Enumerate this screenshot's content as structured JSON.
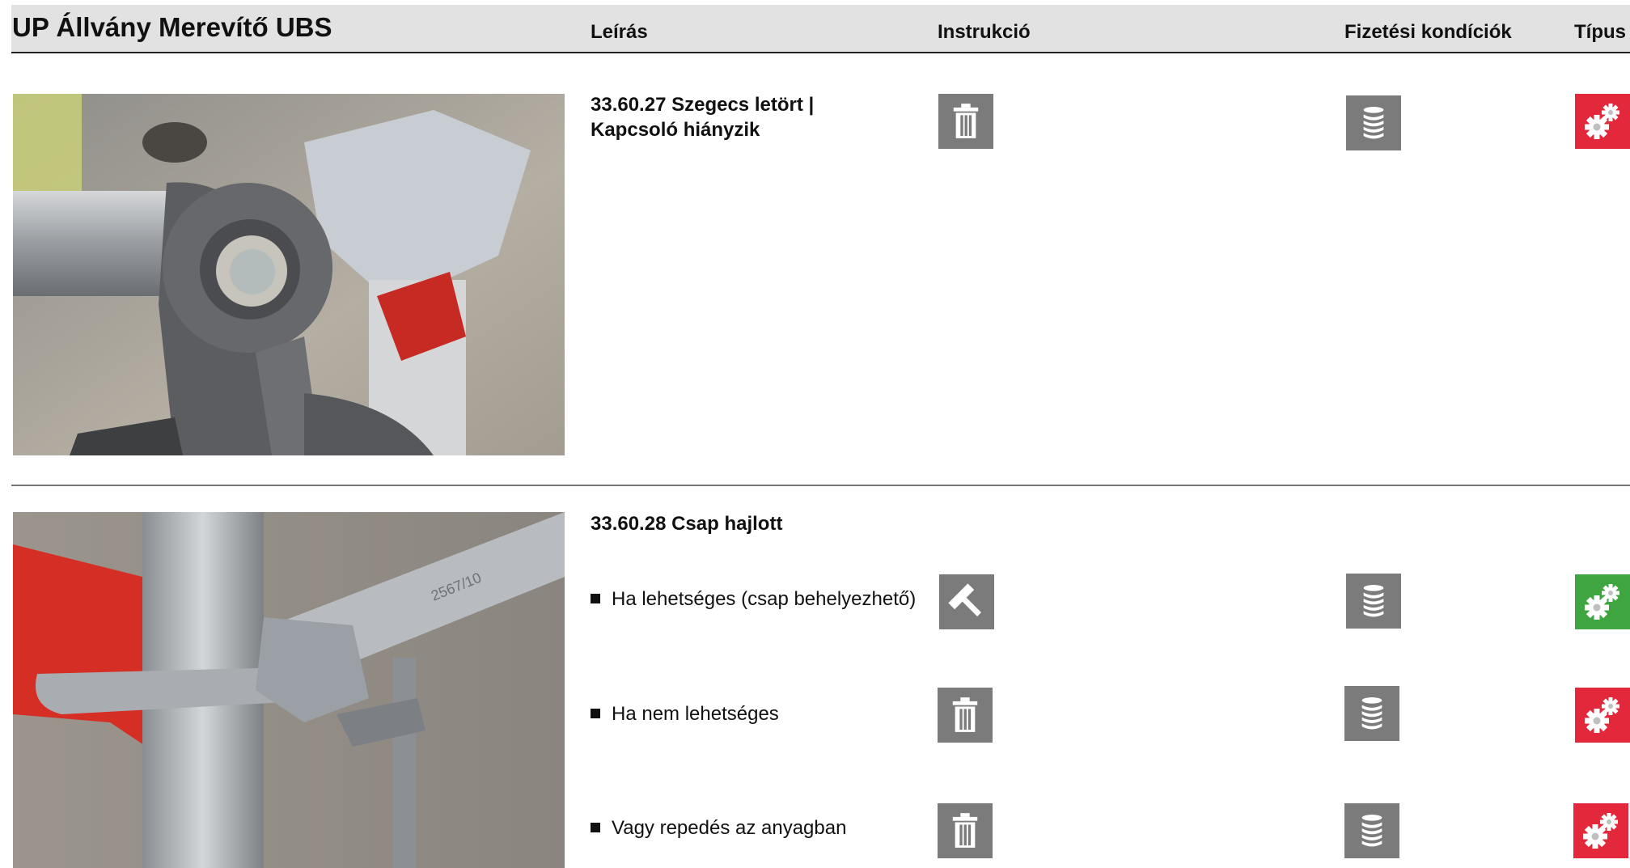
{
  "header": {
    "title": "UP Állvány Merevítő UBS",
    "col_description": "Leírás",
    "col_instruction": "Instrukció",
    "col_payment": "Fizetési kondíciók",
    "col_type": "Típus"
  },
  "items": [
    {
      "code_title_line1": "33.60.27 Szegecs letört |",
      "code_title_line2": "Kapcsoló hiányzik",
      "instruction_icon": "trash-icon",
      "payment_icon": "coin-stack-icon",
      "type_icon": "gears-icon",
      "type_color": "#e2283a"
    },
    {
      "code_title": "33.60.28 Csap hajlott",
      "options": [
        {
          "label": "Ha lehetséges (csap behelyezhető)",
          "instruction_icon": "hammer-icon",
          "payment_icon": "coin-stack-icon",
          "type_icon": "gears-icon",
          "type_color": "#3fa540"
        },
        {
          "label": "Ha nem lehetséges",
          "instruction_icon": "trash-icon",
          "payment_icon": "coin-stack-icon",
          "type_icon": "gears-icon",
          "type_color": "#e2283a"
        },
        {
          "label": "Vagy repedés az anyagban",
          "instruction_icon": "trash-icon",
          "payment_icon": "coin-stack-icon",
          "type_icon": "gears-icon",
          "type_color": "#e2283a"
        }
      ]
    }
  ],
  "colors": {
    "icon_grey": "#7b7b7b",
    "red": "#e2283a",
    "green": "#3fa540",
    "header_bg": "#e2e2e2"
  }
}
